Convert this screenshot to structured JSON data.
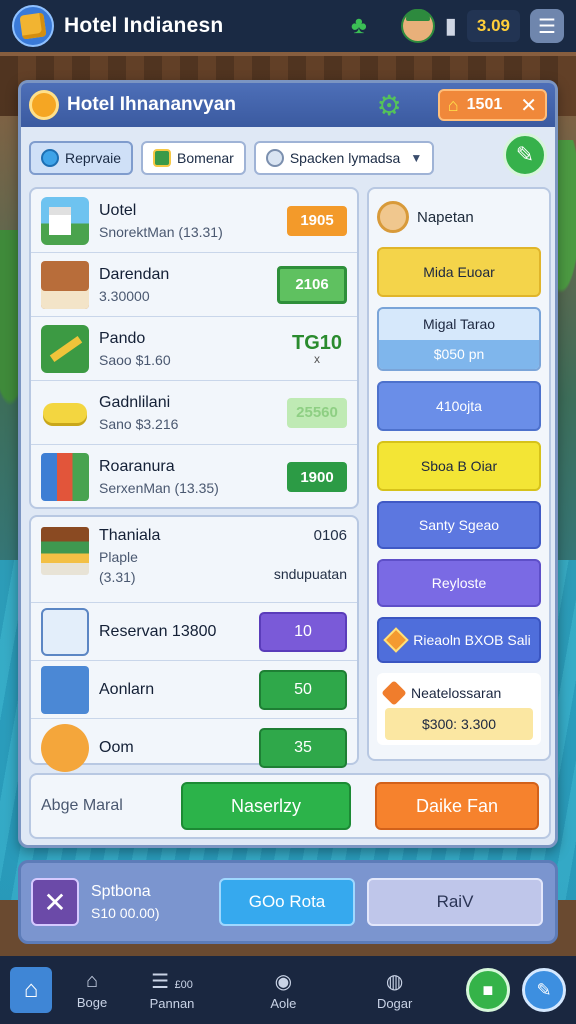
{
  "hud": {
    "title": "Hotel Indianesn",
    "coins": "3.09",
    "menu_icon": "menu-icon"
  },
  "panel": {
    "title": "Hotel Ihnananvyan",
    "chip_value": "1501",
    "close": "✕"
  },
  "tabs": [
    {
      "label": "Reprvaie"
    },
    {
      "label": "Bomenar"
    },
    {
      "label": "Spacken lymadsa"
    }
  ],
  "list1": [
    {
      "title": "Uotel",
      "sub": "SnorektMan (13.31)",
      "value": "1905",
      "icon": "hotel-icon"
    },
    {
      "title": "Darendan",
      "sub": "3.30000",
      "value": "2106",
      "icon": "bed-icon"
    },
    {
      "title": "Pando",
      "sub": "Saoo $1.60",
      "value": "TG10",
      "value_sub": "x",
      "icon": "pen-icon"
    },
    {
      "title": "Gadnlilani",
      "sub": "Sano $3.216",
      "value": "25560",
      "icon": "soap-icon"
    },
    {
      "title": "Roaranura",
      "sub": "SerxenMan (13.35)",
      "value": "1900",
      "icon": "people-icon"
    }
  ],
  "list2": {
    "row1": {
      "title": "Thaniala",
      "l2": "Plaple",
      "l3": "(3.31)",
      "right_top": "0106",
      "right_bot": "sndupuatan"
    },
    "row2": {
      "title": "Reservan 13800",
      "btn": "10"
    },
    "row3": {
      "title": "Aonlarn",
      "btn": "50"
    },
    "row4": {
      "title": "Oom",
      "btn": "35"
    }
  },
  "right": {
    "header": "Napetan",
    "b1": "Mida Euoar",
    "b2_top": "Migal Tarao",
    "b2_bot": "$050 pn",
    "b3": "410ojta",
    "b4": "Sboa B Oiar",
    "b5": "Santy Sgeao",
    "b6": "Reyloste",
    "b7": "Rieaoln BXOB Sali",
    "b8_label": "Neatelossaran",
    "b8_value": "$300: 3.300"
  },
  "strip": {
    "label": "Abge Maral",
    "green": "Naserlzy",
    "orange": "Daike Fan"
  },
  "panel2": {
    "title": "Sptbona",
    "sub": "S10 00.00)",
    "btn1": "GOo Rota",
    "btn2": "RaiV"
  },
  "nav": [
    {
      "label": "Boge"
    },
    {
      "label": "Pannan",
      "badge": "£00"
    },
    {
      "label": "Aole"
    },
    {
      "label": "Dogar"
    }
  ],
  "colors": {
    "accent": "#3b5aa0",
    "orange": "#f39a2a",
    "green": "#2fa84a"
  }
}
